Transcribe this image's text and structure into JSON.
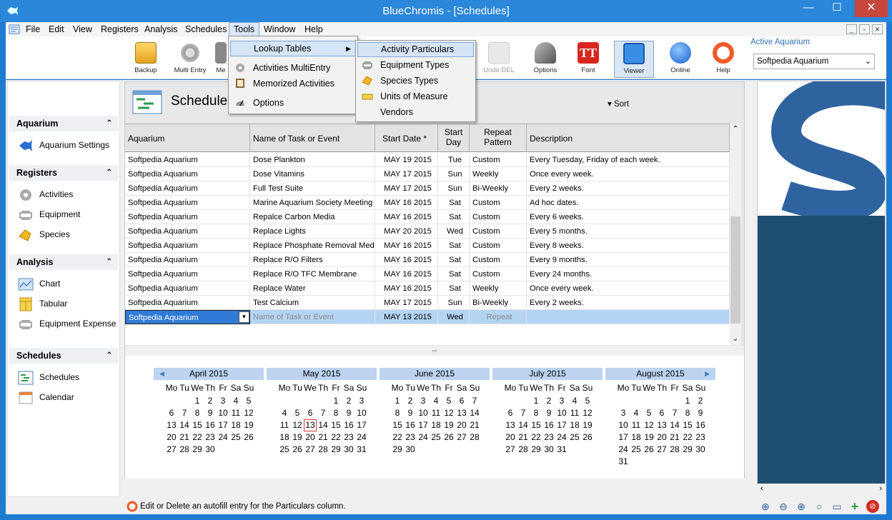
{
  "window": {
    "title": "BlueChromis - [Schedules]",
    "minimize": "—",
    "maximize": "☐",
    "close": "✕"
  },
  "menubar": {
    "items": [
      "File",
      "Edit",
      "View",
      "Registers",
      "Analysis",
      "Schedules",
      "Tools",
      "Window",
      "Help"
    ],
    "mdi": [
      "_",
      "▫",
      "✕"
    ]
  },
  "toolbar": {
    "buttons": [
      "Backup",
      "Multi Entry",
      "Me",
      "Undo DEL",
      "Options",
      "Font",
      "Viewer",
      "Online",
      "Help"
    ],
    "active_aquarium_label": "Active Aquarium",
    "active_aquarium_value": "Softpedia Aquarium"
  },
  "tools_menu": {
    "items": [
      "Lookup Tables",
      "Activities MultiEntry",
      "Memorized Activities",
      "Options"
    ]
  },
  "lookup_submenu": {
    "items": [
      "Activity Particulars",
      "Equipment Types",
      "Species Types",
      "Units of Measure",
      "Vendors"
    ]
  },
  "leftnav": {
    "aquarium": {
      "header": "Aquarium",
      "items": [
        "Aquarium Settings"
      ]
    },
    "registers": {
      "header": "Registers",
      "items": [
        "Activities",
        "Equipment",
        "Species"
      ]
    },
    "analysis": {
      "header": "Analysis",
      "items": [
        "Chart",
        "Tabular",
        "Equipment Expense"
      ]
    },
    "schedules": {
      "header": "Schedules",
      "items": [
        "Schedules",
        "Calendar"
      ]
    }
  },
  "schedules": {
    "title": "Schedule",
    "sort_label": "Sort",
    "columns": [
      "Aquarium",
      "Name of Task or Event",
      "Start Date *",
      "Start Day",
      "Repeat Pattern",
      "Description"
    ],
    "rows": [
      [
        "Softpedia Aquarium",
        "Dose Plankton",
        "MAY 19 2015",
        "Tue",
        "Custom",
        "Every Tuesday, Friday of each week."
      ],
      [
        "Softpedia Aquarium",
        "Dose Vitamins",
        "MAY 17 2015",
        "Sun",
        "Weekly",
        "Once every week."
      ],
      [
        "Softpedia Aquarium",
        "Full Test Suite",
        "MAY 17 2015",
        "Sun",
        "Bi-Weekly",
        "Every 2 weeks."
      ],
      [
        "Softpedia Aquarium",
        "Marine Aquarium Society Meeting",
        "MAY 16 2015",
        "Sat",
        "Custom",
        "Ad hoc dates."
      ],
      [
        "Softpedia Aquarium",
        "Repalce Carbon Media",
        "MAY 16 2015",
        "Sat",
        "Custom",
        "Every 6 weeks."
      ],
      [
        "Softpedia Aquarium",
        "Replace Lights",
        "MAY 20 2015",
        "Wed",
        "Custom",
        "Every 5 months."
      ],
      [
        "Softpedia Aquarium",
        "Replace Phosphate Removal Media",
        "MAY 16 2015",
        "Sat",
        "Custom",
        "Every 8 weeks."
      ],
      [
        "Softpedia Aquarium",
        "Replace R/O Filters",
        "MAY 16 2015",
        "Sat",
        "Custom",
        "Every 9 months."
      ],
      [
        "Softpedia Aquarium",
        "Replace R/O TFC Membrane",
        "MAY 16 2015",
        "Sat",
        "Custom",
        "Every 24 months."
      ],
      [
        "Softpedia Aquarium",
        "Replace Water",
        "MAY 16 2015",
        "Sat",
        "Weekly",
        "Once every week."
      ],
      [
        "Softpedia Aquarium",
        "Test Calcium",
        "MAY 17 2015",
        "Sun",
        "Bi-Weekly",
        "Every 2 weeks."
      ]
    ],
    "new_row": {
      "aquarium": "Softpedia Aquarium",
      "task_placeholder": "Name of Task or Event",
      "start_date": "MAY 13 2015",
      "start_day": "Wed",
      "repeat_placeholder": "Repeat"
    }
  },
  "calendar": {
    "dow": [
      "Mo",
      "Tu",
      "We",
      "Th",
      "Fr",
      "Sa",
      "Su"
    ],
    "today": "13",
    "months": [
      {
        "name": "April 2015",
        "offset": 2,
        "days": 30
      },
      {
        "name": "May 2015",
        "offset": 4,
        "days": 31
      },
      {
        "name": "June 2015",
        "offset": 0,
        "days": 30
      },
      {
        "name": "July 2015",
        "offset": 2,
        "days": 31
      },
      {
        "name": "August 2015",
        "offset": 5,
        "days": 31
      }
    ]
  },
  "statusbar": {
    "text": "Edit or Delete an autofill entry for the Particulars column."
  },
  "colors": {
    "accent": "#2b87d9",
    "selection": "#b4d4f4",
    "month_header": "#bcd4f0",
    "logo_dark": "#1f4f70",
    "logo_blue": "#2f63a0"
  }
}
